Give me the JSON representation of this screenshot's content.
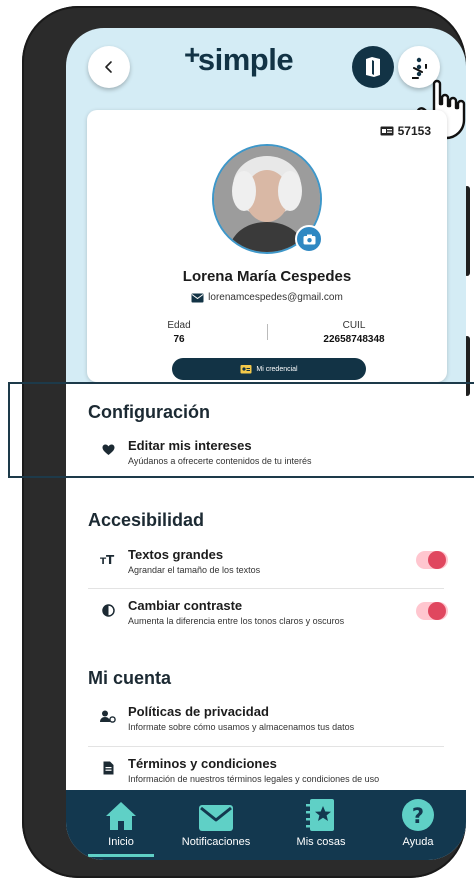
{
  "header": {
    "logo_plus": "+",
    "logo_text": "simple"
  },
  "profile": {
    "member_id": "57153",
    "name": "Lorena María Cespedes",
    "email": "lorenamcespedes@gmail.com",
    "stats": [
      {
        "label": "Edad",
        "value": "76"
      },
      {
        "label": "CUIL",
        "value": "22658748348"
      }
    ],
    "credential_label": "Mi credencial"
  },
  "sections": {
    "config": {
      "title": "Configuración",
      "items": [
        {
          "title": "Editar mis intereses",
          "desc": "Ayúdanos a ofrecerte contenidos de tu interés",
          "icon": "heart-icon"
        }
      ]
    },
    "accessibility": {
      "title": "Accesibilidad",
      "items": [
        {
          "title": "Textos grandes",
          "desc": "Agrandar el tamaño de los textos",
          "icon": "text-size-icon",
          "toggle": true
        },
        {
          "title": "Cambiar contraste",
          "desc": "Aumenta la diferencia entre los tonos claros y oscuros",
          "icon": "contrast-icon",
          "toggle": true
        }
      ]
    },
    "account": {
      "title": "Mi cuenta",
      "items": [
        {
          "title": "Políticas de privacidad",
          "desc": "Informate sobre cómo usamos y almacenamos tus datos",
          "icon": "privacy-icon"
        },
        {
          "title": "Términos y condiciones",
          "desc": "Información de nuestros términos legales y condiciones de uso",
          "icon": "document-icon"
        }
      ]
    }
  },
  "nav": [
    {
      "label": "Inicio",
      "icon": "home-icon",
      "active": true
    },
    {
      "label": "Notificaciones",
      "icon": "envelope-icon"
    },
    {
      "label": "Mis cosas",
      "icon": "notebook-star-icon"
    },
    {
      "label": "Ayuda",
      "icon": "help-icon"
    }
  ],
  "colors": {
    "brand_dark": "#13384f",
    "accent_blue": "#2f88c2",
    "toggle_on": "#e0475f",
    "nav_active": "#5fd0c6"
  }
}
